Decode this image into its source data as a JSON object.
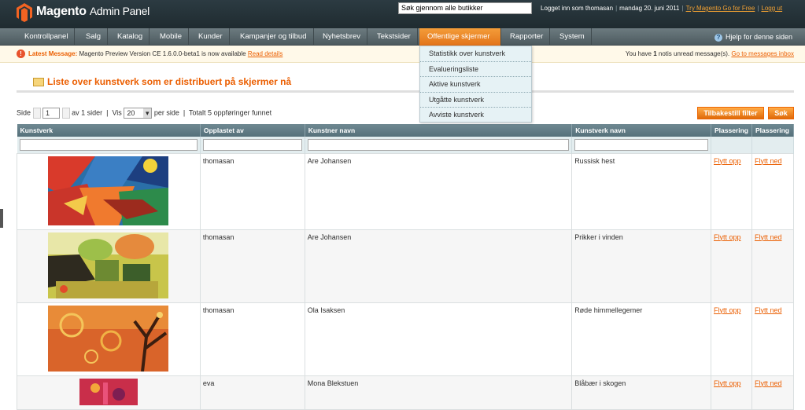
{
  "header": {
    "logo_text": "Magento",
    "logo_sub": "Admin Panel",
    "search_value": "Søk gjennom alle butikker",
    "logged_in": "Logget inn som thomasan",
    "date": "mandag 20. juni 2011",
    "try_link": "Try Magento Go for Free",
    "logout": "Logg ut"
  },
  "nav": {
    "items": [
      "Kontrollpanel",
      "Salg",
      "Katalog",
      "Mobile",
      "Kunder",
      "Kampanjer og tilbud",
      "Nyhetsbrev",
      "Tekstsider",
      "Offentlige skjermer",
      "Rapporter",
      "System"
    ],
    "active": "Offentlige skjermer",
    "help": "Hjelp for denne siden"
  },
  "dropdown": {
    "items": [
      "Statistikk over kunstverk",
      "Evalueringsliste",
      "Aktive kunstverk",
      "Utgåtte kunstverk",
      "Avviste kunstverk"
    ]
  },
  "message": {
    "label": "Latest Message:",
    "text": "Magento Preview Version CE 1.6.0.0-beta1 is now available",
    "read": "Read details",
    "right_pre": "You have",
    "right_count": "1",
    "right_post": "notis unread message(s).",
    "right_link": "Go to messages inbox"
  },
  "page": {
    "title": "Liste over kunstverk som er distribuert på skjermer nå"
  },
  "pager": {
    "side_label": "Side",
    "page": "1",
    "of": "av 1 sider",
    "vis": "Vis",
    "per_page": "20",
    "per_side": "per side",
    "total": "Totalt 5 oppføringer funnet",
    "reset_btn": "Tilbakestill filter",
    "search_btn": "Søk"
  },
  "grid": {
    "columns": [
      "Kunstverk",
      "Opplastet av",
      "Kunstner navn",
      "Kunstverk navn",
      "Plassering",
      "Plassering"
    ],
    "rows": [
      {
        "uploader": "thomasan",
        "artist": "Are Johansen",
        "name": "Russisk hest",
        "up": "Flytt opp",
        "down": "Flytt ned"
      },
      {
        "uploader": "thomasan",
        "artist": "Are Johansen",
        "name": "Prikker i vinden",
        "up": "Flytt opp",
        "down": "Flytt ned"
      },
      {
        "uploader": "thomasan",
        "artist": "Ola Isaksen",
        "name": "Røde himmellegemer",
        "up": "Flytt opp",
        "down": "Flytt ned"
      },
      {
        "uploader": "eva",
        "artist": "Mona Blekstuen",
        "name": "Blåbær i skogen",
        "up": "Flytt opp",
        "down": "Flytt ned"
      }
    ]
  },
  "colors": {
    "accent": "#eb5e00",
    "nav_active": "#f08a29",
    "header_bg": "#26343a"
  }
}
